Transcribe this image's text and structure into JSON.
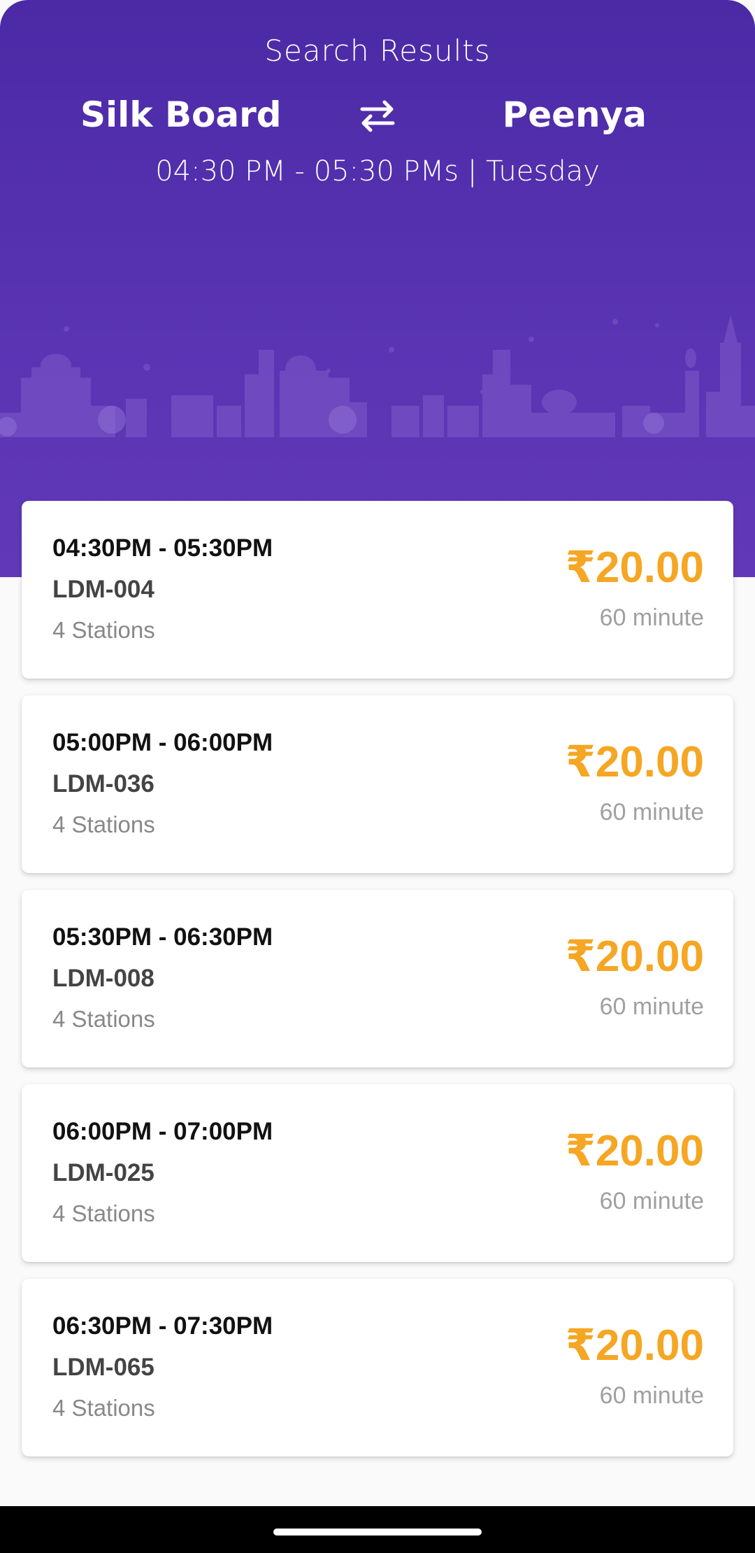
{
  "header": {
    "title": "Search Results",
    "origin": "Silk Board",
    "destination": "Peenya",
    "time_range": "04:30 PM - 05:30 PMs | Tuesday",
    "background_color": "#5030a8"
  },
  "colors": {
    "price": "#f5a623",
    "card_bg": "#ffffff",
    "page_bg": "#fafafa"
  },
  "results": [
    {
      "time": "04:30PM - 05:30PM",
      "code": "LDM-004",
      "stations": "4 Stations",
      "price": "₹20.00",
      "duration": "60 minute"
    },
    {
      "time": "05:00PM - 06:00PM",
      "code": "LDM-036",
      "stations": "4 Stations",
      "price": "₹20.00",
      "duration": "60 minute"
    },
    {
      "time": "05:30PM - 06:30PM",
      "code": "LDM-008",
      "stations": "4 Stations",
      "price": "₹20.00",
      "duration": "60 minute"
    },
    {
      "time": "06:00PM - 07:00PM",
      "code": "LDM-025",
      "stations": "4 Stations",
      "price": "₹20.00",
      "duration": "60 minute"
    },
    {
      "time": "06:30PM - 07:30PM",
      "code": "LDM-065",
      "stations": "4 Stations",
      "price": "₹20.00",
      "duration": "60 minute"
    }
  ],
  "icons": {
    "swap": "swap-arrows-icon",
    "skyline": "city-skyline-illustration"
  }
}
